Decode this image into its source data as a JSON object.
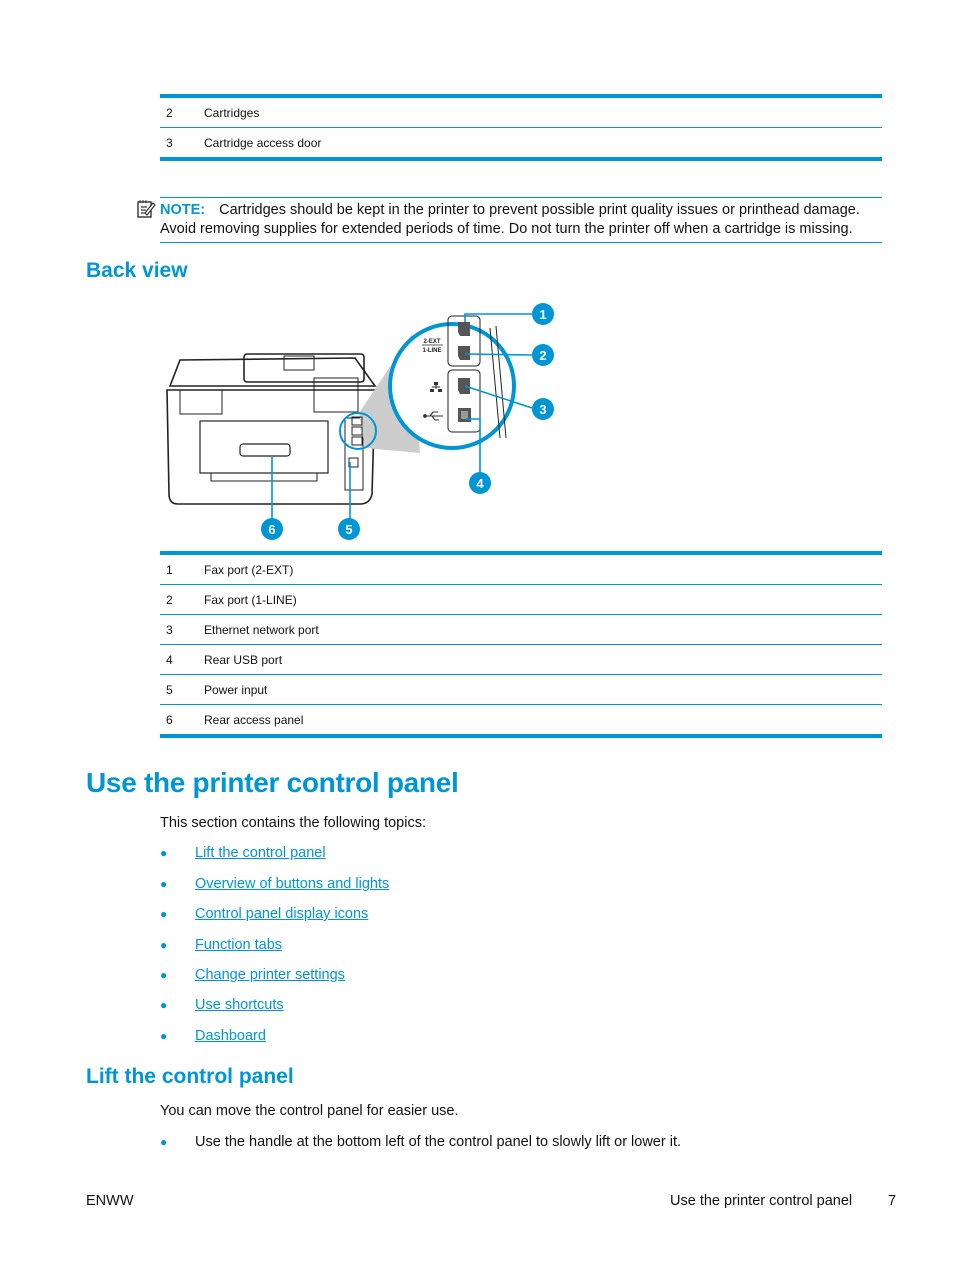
{
  "top_table": {
    "rows": [
      {
        "num": "2",
        "label": "Cartridges"
      },
      {
        "num": "3",
        "label": "Cartridge access door"
      }
    ]
  },
  "note": {
    "label": "NOTE:",
    "text": "Cartridges should be kept in the printer to prevent possible print quality issues or printhead damage. Avoid removing supplies for extended periods of time. Do not turn the printer off when a cartridge is missing.",
    "icon": "note-icon"
  },
  "back_view": {
    "heading": "Back view",
    "figure": {
      "port_labels": [
        "2-EXT",
        "1-LINE"
      ],
      "callouts": [
        "1",
        "2",
        "3",
        "4",
        "5",
        "6"
      ]
    },
    "table": {
      "rows": [
        {
          "num": "1",
          "label": "Fax port (2-EXT)"
        },
        {
          "num": "2",
          "label": "Fax port (1-LINE)"
        },
        {
          "num": "3",
          "label": "Ethernet network port"
        },
        {
          "num": "4",
          "label": "Rear USB port"
        },
        {
          "num": "5",
          "label": "Power input"
        },
        {
          "num": "6",
          "label": "Rear access panel"
        }
      ]
    }
  },
  "control_panel": {
    "heading": "Use the printer control panel",
    "intro": "This section contains the following topics:",
    "topics": [
      "Lift the control panel",
      "Overview of buttons and lights",
      "Control panel display icons",
      "Function tabs",
      "Change printer settings",
      "Use shortcuts",
      "Dashboard"
    ]
  },
  "lift": {
    "heading": "Lift the control panel",
    "intro": "You can move the control panel for easier use.",
    "bullets": [
      "Use the handle at the bottom left of the control panel to slowly lift or lower it."
    ]
  },
  "footer": {
    "left": "ENWW",
    "section": "Use the printer control panel",
    "page": "7"
  },
  "colors": {
    "accent": "#0096d6"
  }
}
